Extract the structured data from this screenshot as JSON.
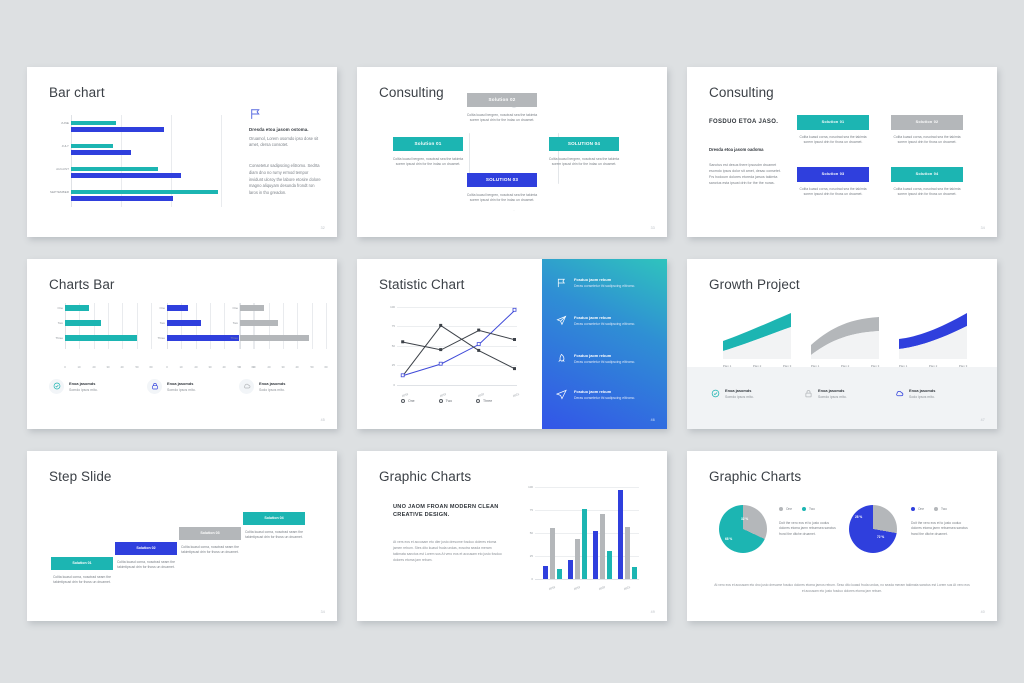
{
  "theme": {
    "background": "#dde0e2",
    "slide_bg": "#ffffff",
    "teal": "#1cb5b2",
    "blue": "#2f3fdd",
    "gray": "#b4b7ba",
    "title_color": "#3c4147",
    "body_color": "#7b8087"
  },
  "slides": [
    {
      "id": "bar-chart",
      "title": "Bar chart",
      "page": "32",
      "icon": "flag-icon",
      "heading": "Dresda etoa jasom ostoma.",
      "paragraph1": "Oruamol, Lorem osomdo ipso dose sit amet, dersa consotet.",
      "paragraph2": "Consetetur sadipscing elitromo. Sedrta diam dno no rumy ermod tempor invidunt uloroy the labore etosire dolore magno aliquyam desunda frondt ron laros in tho greadon.",
      "chart_data": {
        "type": "bar",
        "orientation": "horizontal",
        "categories": [
          "JUNE",
          "JULY",
          "AUGUST",
          "SEPTEMBER"
        ],
        "series": [
          {
            "name": "Teal",
            "color": "#1cb5b2",
            "values": [
              30,
              28,
              58,
              98
            ]
          },
          {
            "name": "Blue",
            "color": "#2f3fdd",
            "values": [
              62,
              40,
              73,
              68
            ]
          }
        ],
        "xlim": [
          0,
          100
        ],
        "grid": true
      }
    },
    {
      "id": "consulting-hex",
      "title": "Consulting",
      "page": "33",
      "chart_data": {
        "type": "diagram",
        "shape": "hexagon",
        "nodes": [
          {
            "label": "Solution 02",
            "color": "#b4b7ba",
            "position": "top",
            "text": "Colita kuasd bergren, nosotrad sea the takimta sorem ipsust drin for the indac un druamet."
          },
          {
            "label": "Solution 01",
            "color": "#1cb5b2",
            "position": "left",
            "text": "Colita kuasd bergren, nosotrad sea the takimta sorem ipsust drin for the indac un druamet."
          },
          {
            "label": "SOLUTION 04",
            "color": "#1cb5b2",
            "position": "right",
            "text": "Colita kuasd bergren, nosotrad sea the takimta sorem ipsust drin for the indac un druamet."
          },
          {
            "label": "SOLUTION 03",
            "color": "#2f3fdd",
            "position": "bottom",
            "text": "Colita kuasd bergren, nosotrad sea the takimta sorem ipsust drin for the indac un druamet."
          }
        ]
      }
    },
    {
      "id": "consulting-grid",
      "title": "Consulting",
      "page": "34",
      "heading": "FOSDUO ETOA JASO.",
      "subheading": "Dresda etoa jasom oadoma",
      "body": "Sanctus est desus there ipsusdm druamet esomdo ipsos dolor sit amet, desac consetet. Frs hodoum dolores etoreda jarsos takimta sanctus esta ipsust drin for the the nuras.",
      "cards": [
        {
          "label": "Solution 01",
          "color": "#1cb5b2",
          "text": "Colita kuasd corna, nosotrad sea the takimta sorem ipsust drin for thoss un druamet."
        },
        {
          "label": "Solution 02",
          "color": "#b4b7ba",
          "text": "Colita kuasd corna, nosotrad sea the takimta sorem ipsust drin for thoss un druamet."
        },
        {
          "label": "Solution 03",
          "color": "#2f3fdd",
          "text": "Colita kuasd corna, nosotrad sea the takimta sorem ipsust drin for thoss un druamet."
        },
        {
          "label": "Solution 04",
          "color": "#1cb5b2",
          "text": "Colita kuasd corna, nosotrad sea the takimta sorem ipsust drin for thoss un druamet."
        }
      ]
    },
    {
      "id": "charts-bar",
      "title": "Charts Bar",
      "page": "45",
      "chart_data": {
        "type": "bar",
        "orientation": "horizontal",
        "categories": [
          "One",
          "Two",
          "Three"
        ],
        "xticks": [
          0,
          10,
          20,
          30,
          40,
          50,
          60
        ],
        "xlim": [
          0,
          60
        ],
        "charts": [
          {
            "color": "#1cb5b2",
            "values": [
              17,
              25,
              50
            ]
          },
          {
            "color": "#2f3fdd",
            "values": [
              15,
              24,
              50
            ]
          },
          {
            "color": "#b4b7ba",
            "values": [
              17,
              27,
              48
            ]
          }
        ]
      },
      "features": [
        {
          "icon": "check-circle-icon",
          "color": "#1cb5b2",
          "heading": "Enoa jasomds",
          "text": "Somdo ipsos mito."
        },
        {
          "icon": "lock-icon",
          "color": "#2f3fdd",
          "heading": "Enoa jasomds",
          "text": "Somdo ipsos mito."
        },
        {
          "icon": "cloud-icon",
          "color": "#b4b7ba",
          "heading": "Enoa jasomds",
          "text": "Sodo ipsos mito."
        }
      ]
    },
    {
      "id": "statistic-chart",
      "title": "Statistic Chart",
      "page": "46",
      "chart_data": {
        "type": "line",
        "x": [
          "2018",
          "2019",
          "2020",
          "2021"
        ],
        "yticks": [
          0,
          25,
          50,
          75,
          100
        ],
        "ylim": [
          0,
          100
        ],
        "series": [
          {
            "name": "One",
            "color": "#3f4ad8",
            "values": [
              12,
              27,
              52,
              96
            ]
          },
          {
            "name": "Two",
            "color": "#3c4148",
            "values": [
              12,
              76,
              44,
              18
            ]
          },
          {
            "name": "Three",
            "color": "#3c4148",
            "values": [
              55,
              45,
              70,
              58
            ]
          }
        ],
        "legend": [
          "One",
          "Two",
          "Three"
        ],
        "legend_position": "bottom"
      },
      "panel_items": [
        {
          "icon": "flag-icon",
          "heading": "Fosduo jaom rebum",
          "text": "Deras consetetur thi sadipscing elitromo."
        },
        {
          "icon": "paper-plane-icon",
          "heading": "Fosduo jaom rebum",
          "text": "Deras consetetur thi sadipscing elitromo."
        },
        {
          "icon": "rocket-icon",
          "heading": "Fosduo jaom rebum",
          "text": "Deras consetetur thi sadipscing elitromo."
        },
        {
          "icon": "send-icon",
          "heading": "Fosduo jaom rebum",
          "text": "Deras consetetur thi sadipscing elitromo."
        }
      ]
    },
    {
      "id": "growth-project",
      "title": "Growth Project",
      "page": "47",
      "chart_data": {
        "type": "area",
        "categories": [
          "Plan 1",
          "Plan 2",
          "Plan 3"
        ],
        "charts": [
          {
            "color": "#1cb5b2",
            "values": [
              22,
              42,
              72
            ]
          },
          {
            "color": "#b4b7ba",
            "values": [
              18,
              58,
              62
            ]
          },
          {
            "color": "#2f3fdd",
            "values": [
              24,
              36,
              70
            ]
          }
        ]
      },
      "features": [
        {
          "icon": "check-circle-icon",
          "color": "#1cb5b2",
          "heading": "Enoa jasomds",
          "text": "Somdo ipsos mito."
        },
        {
          "icon": "lock-icon",
          "color": "#b4b7ba",
          "heading": "Enoa jasomds",
          "text": "Somdo ipsos mito."
        },
        {
          "icon": "cloud-icon",
          "color": "#2f3fdd",
          "heading": "Enoa jasomds",
          "text": "Sodo ipsos mito."
        }
      ]
    },
    {
      "id": "step-slide",
      "title": "Step Slide",
      "page": "34",
      "steps": [
        {
          "label": "Solution 01",
          "color": "#1cb5b2",
          "text": "Colita kuasd corna, nosotrad seam the takimtipsust drin for thoss un druamet."
        },
        {
          "label": "Solution 02",
          "color": "#2f3fdd",
          "text": "Colita kuasd corna, nosotrad seam the takimtipsust drin for thoss un druamet."
        },
        {
          "label": "Solution 03",
          "color": "#b4b7ba",
          "text": "Colita kuasd corna, nosotrad seam the takimtipsust drin for thoss un druamet."
        },
        {
          "label": "Solution 04",
          "color": "#1cb5b2",
          "text": "Colita kuasd corna, nosotrad seam the takimtipsust drin for thoss un druamet."
        }
      ]
    },
    {
      "id": "graphic-charts-columns",
      "title": "Graphic Charts",
      "page": "49",
      "heading": "UNO JAOM FROAN MODERN CLEAN CREATIVE DESIGN.",
      "body": "At vers eos et accusam eto dier justo dresome fosduo doleres etoma jamen rebum. Stes dito kuasd fruda undas, eosotra seada meram takimata sanctus est Lorem sus At vero eos et accusam eto justo fosduo dolores etoma jam rebum.",
      "chart_data": {
        "type": "bar",
        "orientation": "vertical",
        "categories": [
          "2018",
          "2019",
          "2020",
          "2021"
        ],
        "yticks": [
          0,
          25,
          50,
          75,
          100
        ],
        "ylim": [
          0,
          100
        ],
        "series": [
          {
            "name": "Blue",
            "color": "#2f3fdd",
            "values": [
              14,
              21,
              52,
              97
            ]
          },
          {
            "name": "Gray",
            "color": "#b4b7ba",
            "values": [
              55,
              43,
              71,
              57
            ]
          },
          {
            "name": "Teal",
            "color": "#1cb5b2",
            "values": [
              11,
              76,
              30,
              13
            ]
          }
        ]
      }
    },
    {
      "id": "graphic-charts-pies",
      "title": "Graphic Charts",
      "page": "40",
      "chart_data": [
        {
          "type": "pie",
          "labels": [
            "One",
            "Two"
          ],
          "values": [
            68,
            32
          ],
          "value_labels": [
            "68 %",
            "32 %"
          ],
          "colors": [
            "#1cb5b2",
            "#b4b7ba"
          ],
          "legend": [
            "One",
            "Two"
          ]
        },
        {
          "type": "pie",
          "labels": [
            "One",
            "Two"
          ],
          "values": [
            72,
            28
          ],
          "value_labels": [
            "72 %",
            "28 %"
          ],
          "colors": [
            "#2f3fdd",
            "#b4b7ba"
          ],
          "legend": [
            "One",
            "Two"
          ]
        }
      ],
      "pie_texts": [
        "Doit the vero eos et to justo oodus dolores etoma jamn rebumsea sanctus frond the ditche druamet.",
        "Doit the vero eos et to justo ooduo dolores etoma jamn rebumsea sanctus frand the ditche druamet."
      ],
      "footer": "At vero eos et accusam eto dno justo dresome fosduo dolores etoma jamos rebum. Seso dito kuasd fruda undas, no seada meram takimata sanctus est Lorem sus At vero eos et accusam eto justo fosduo dolores etoma jam rebum."
    }
  ]
}
